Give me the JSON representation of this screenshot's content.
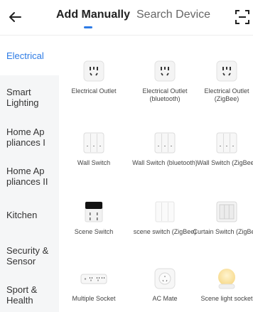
{
  "header": {
    "tabs": [
      {
        "label": "Add Manually"
      },
      {
        "label": "Search Device"
      }
    ]
  },
  "sidebar": {
    "items": [
      {
        "label": "Electrical"
      },
      {
        "label": "Smart Lighting"
      },
      {
        "label": "Home Ap pliances I"
      },
      {
        "label": "Home Ap pliances II"
      },
      {
        "label": "Kitchen"
      },
      {
        "label": "Security & Sensor"
      },
      {
        "label": "Sport & Health"
      }
    ]
  },
  "devices": [
    {
      "label": "Electrical Outlet",
      "icon": "outlet-icon"
    },
    {
      "label": "Electrical Outlet (bluetooth)",
      "icon": "outlet-icon"
    },
    {
      "label": "Electrical Outlet (ZigBee)",
      "icon": "outlet-icon"
    },
    {
      "label": "Wall Switch",
      "icon": "wall-switch-icon"
    },
    {
      "label": "Wall Switch (bluetooth)",
      "icon": "wall-switch-icon"
    },
    {
      "label": "Wall Switch (ZigBee)",
      "icon": "wall-switch-icon"
    },
    {
      "label": "Scene Switch",
      "icon": "scene-switch-icon"
    },
    {
      "label": "scene switch (ZigBee)",
      "icon": "scene-switch-zigbee-icon"
    },
    {
      "label": "Curtain Switch (ZigBee)",
      "icon": "curtain-switch-icon"
    },
    {
      "label": "Multiple Socket",
      "icon": "multiple-socket-icon"
    },
    {
      "label": "AC Mate",
      "icon": "ac-mate-icon"
    },
    {
      "label": "Scene light socket",
      "icon": "scene-light-icon"
    }
  ],
  "colors": {
    "accent": "#2d7be5",
    "sidebar_bg": "#f5f6f7"
  }
}
